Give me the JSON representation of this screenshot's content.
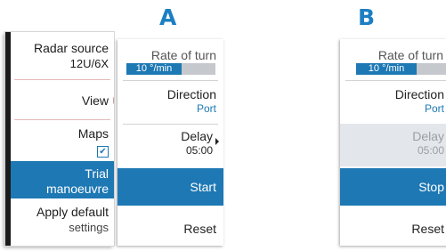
{
  "labels": {
    "a": "A",
    "b": "B"
  },
  "left_menu": {
    "radar_source": {
      "label": "Radar source",
      "value": "12U/6X"
    },
    "view": "View",
    "maps": "Maps",
    "maps_checked": true,
    "trial": {
      "line1": "Trial",
      "line2": "manoeuvre"
    },
    "apply": {
      "line1": "Apply default",
      "line2": "settings"
    }
  },
  "panel_a": {
    "rate_of_turn": {
      "label": "Rate of turn",
      "value": "10 °/min",
      "level": 0.62
    },
    "direction": {
      "label": "Direction",
      "value": "Port"
    },
    "delay": {
      "label": "Delay",
      "value": "05:00"
    },
    "start": "Start",
    "reset": "Reset"
  },
  "panel_b": {
    "rate_of_turn": {
      "label": "Rate of turn",
      "value": "10 °/min",
      "level": 0.62
    },
    "direction": {
      "label": "Direction",
      "value": "Port"
    },
    "delay": {
      "label": "Delay",
      "value": "05:00"
    },
    "stop": "Stop",
    "reset": "Reset"
  },
  "colors": {
    "accent": "#1d78b4",
    "label": "#1c7fc2",
    "dimmed_bg": "#e3e6ea"
  },
  "icons": {
    "submenu_arrow": "chevron-right-icon",
    "checkbox": "check-icon"
  }
}
